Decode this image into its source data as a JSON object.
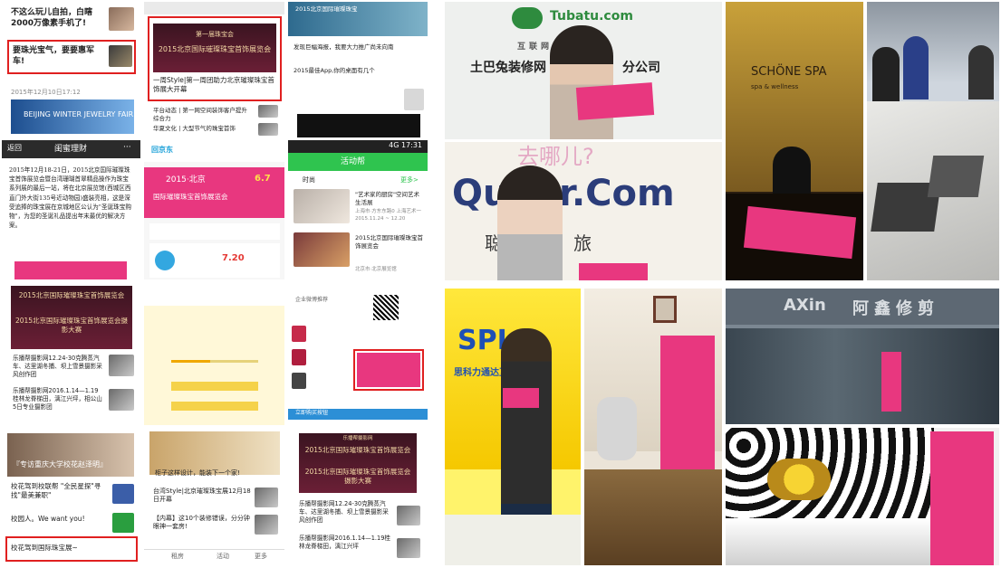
{
  "tile1": {
    "headline": "不这么玩儿自拍，白瞎2000万像素手机了!",
    "highlight": "要珠光宝气，要要惠军车!",
    "timestamp": "2015年12月10日17:12",
    "banner": "BEIJING WINTER JEWELRY FAIR"
  },
  "tile2": {
    "badge": "第一届珠宝会",
    "banner_line1": "2015北京国际璀璨珠宝首饰展览会",
    "banner_line2": "一周Style|第一周团助力北京璀璨珠宝首饰展大开幕",
    "row1": "平台动态 | 第一网空间装饰客户提升综合力",
    "row2": "华夏文化 | 大型节气的珠宝首饰"
  },
  "tile3": {
    "tag": "2015北京国际璀璨珠宝",
    "row1": "发现巨幅海报，我要大力推广尚未向南",
    "row2": "2015最佳App,你的桌面有几个"
  },
  "tile4": {
    "back": "返回",
    "title": "闺蜜理财",
    "more": "···",
    "body": "2015年12月18-21日，2015北京国际璀璨珠宝首饰展览会暨台湾珊瑚首翠精品操作为珠宝系列展的最后一站，将在北京展览馆(西城区西直门外大街135号近动物园)盛装亮相，这是深受追捧的珠宝展在京城地区公认为\"圣诞珠宝购物\"，为您的圣诞礼品提出年末最优的解决方案。"
  },
  "tile5": {
    "logo": "回京东",
    "banner_line1": "2015·北京",
    "banner_line2": "国际璀璨珠宝首饰展览会",
    "sale": "6.7",
    "price": "7.20"
  },
  "tile6": {
    "status": "4G 17:31",
    "header": "活动帮",
    "tab": "时尚",
    "more": "更多>",
    "item1": "\"艺术家的厨房\"空间艺术生活展",
    "item1_meta": "上海市·方东东路0 上海艺术一",
    "item1_date": "2015.11.24 ~ 12.20",
    "item2": "2015北京国际璀璨珠宝首饰展览会",
    "item2_meta": "北京市·北京展览馆"
  },
  "tile7": {
    "banner_line1": "2015北京国际璀璨珠宝首饰展览会",
    "banner_line2": "2015北京国际璀璨珠宝首饰展览会摄影大赛",
    "row1": "乐播帮摄影网12.24-30克腾蒸汽车、达里湖冬捕、坝上雪景摄影采风创作团",
    "row2": "乐播帮摄影网2016.1.14—1.19桂林龙脊梯田，漓江兴坪，相公山5日专业摄影团"
  },
  "tile8": {
    "progress_fraction": 0.45
  },
  "tile9": {
    "label": "企业微博推荐",
    "footer": "立即购买按钮"
  },
  "tile10": {
    "caption": "『专访重庆大学校花赵泽明』",
    "row1": "校花驾到校联帮 \"全民星探\"寻找\"最美兼职\"",
    "row2": "校园人。We want you!",
    "highlight": "校花驾到国际珠宝展~"
  },
  "tile11": {
    "row1": "柜子这样设计，能装下一个家!",
    "row2": "台湾Style|北京璀璨珠宝展12月18日开幕",
    "row3": "【内幕】这10个装修错误，分分钟眼神一套房!",
    "nav": [
      "租房",
      "活动",
      "更多"
    ]
  },
  "tile12": {
    "banner_small": "乐播帮摄影网",
    "banner_line1": "2015北京国际璀璨珠宝首饰展览会",
    "banner_line2": "2015北京国际璀璨珠宝首饰展览会摄影大赛",
    "row1": "乐播帮摄影网12.24-30克腾蒸汽车、达里湖冬捕、坝上雪景摄影采风创作团",
    "row2": "乐播帮摄影网2016.1.14—1.19桂林龙脊梯田，漓江兴坪"
  },
  "photos": {
    "tubatu_url": "Tubatu.com",
    "tubatu_slogan": "互联网装修",
    "tubatu_name": "土巴兔装修网",
    "tubatu_tail": "分公司",
    "schone": "SCHÖNE SPA",
    "schone_sub": "spa & wellness",
    "qunar": "Qunar.Com",
    "qunar_question": "去哪儿?",
    "qunar_slogan": "聪  你  的  旅",
    "spi": "SPI",
    "spi_sub": "思科力通达互联网",
    "axin": "AXin",
    "shop": "阿鑫修剪"
  },
  "colors": {
    "highlight": "#e02020",
    "pink": "#e8377f",
    "green_bar": "#2fc44f",
    "banner_dark": "#4a1a2a"
  }
}
